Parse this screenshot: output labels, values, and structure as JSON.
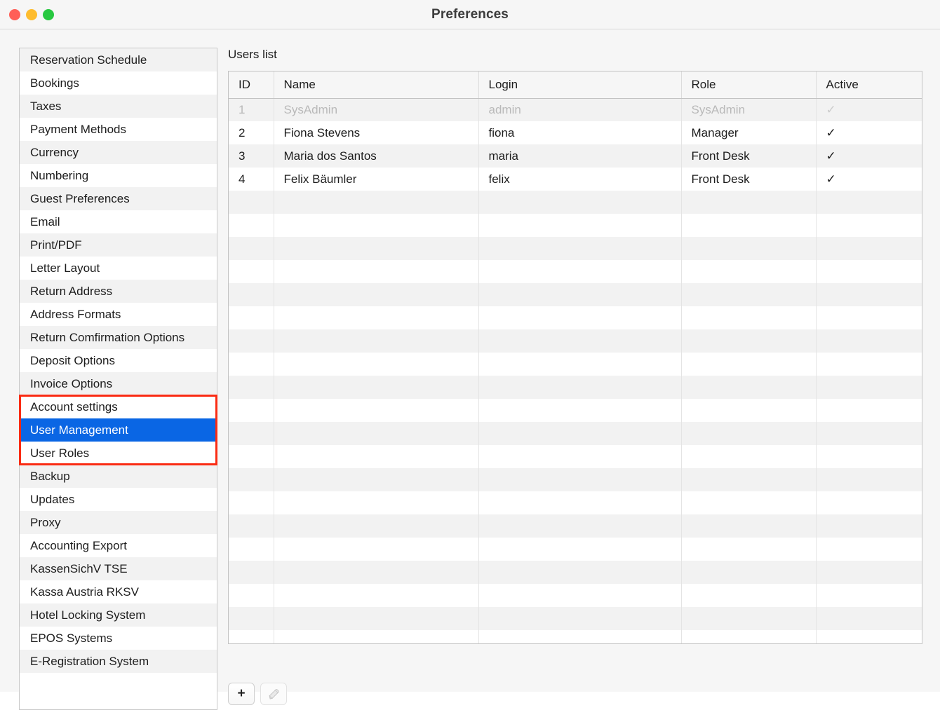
{
  "window": {
    "title": "Preferences",
    "traffic_lights": [
      {
        "name": "close-button",
        "color": "#ff5f57"
      },
      {
        "name": "minimize-button",
        "color": "#febc2e"
      },
      {
        "name": "zoom-button",
        "color": "#28c840"
      }
    ]
  },
  "sidebar": {
    "items": [
      {
        "label": "Reservation Schedule",
        "selected": false
      },
      {
        "label": "Bookings",
        "selected": false
      },
      {
        "label": "Taxes",
        "selected": false
      },
      {
        "label": "Payment Methods",
        "selected": false
      },
      {
        "label": "Currency",
        "selected": false
      },
      {
        "label": "Numbering",
        "selected": false
      },
      {
        "label": "Guest Preferences",
        "selected": false
      },
      {
        "label": "Email",
        "selected": false
      },
      {
        "label": "Print/PDF",
        "selected": false
      },
      {
        "label": "Letter Layout",
        "selected": false
      },
      {
        "label": "Return Address",
        "selected": false
      },
      {
        "label": "Address Formats",
        "selected": false
      },
      {
        "label": "Return Comfirmation Options",
        "selected": false
      },
      {
        "label": "Deposit Options",
        "selected": false
      },
      {
        "label": "Invoice Options",
        "selected": false
      },
      {
        "label": "Account settings",
        "selected": false
      },
      {
        "label": "User Management",
        "selected": true
      },
      {
        "label": "User Roles",
        "selected": false
      },
      {
        "label": "Backup",
        "selected": false
      },
      {
        "label": "Updates",
        "selected": false
      },
      {
        "label": "Proxy",
        "selected": false
      },
      {
        "label": "Accounting Export",
        "selected": false
      },
      {
        "label": "KassenSichV TSE",
        "selected": false
      },
      {
        "label": "Kassa Austria RKSV",
        "selected": false
      },
      {
        "label": "Hotel Locking System",
        "selected": false
      },
      {
        "label": "EPOS Systems",
        "selected": false
      },
      {
        "label": "E-Registration System",
        "selected": false
      }
    ],
    "selected_color": "#0a66e4"
  },
  "annotation": {
    "highlight_color": "#fa2b13",
    "highlighted_items": [
      "Account settings",
      "User Management",
      "User Roles"
    ]
  },
  "main": {
    "label": "Users list",
    "table": {
      "columns": [
        "ID",
        "Name",
        "Login",
        "Role",
        "Active"
      ],
      "rows": [
        {
          "id": "1",
          "name": "SysAdmin",
          "login": "admin",
          "role": "SysAdmin",
          "active": "✓",
          "disabled": true
        },
        {
          "id": "2",
          "name": "Fiona Stevens",
          "login": "fiona",
          "role": "Manager",
          "active": "✓",
          "disabled": false
        },
        {
          "id": "3",
          "name": "Maria dos Santos",
          "login": "maria",
          "role": "Front Desk",
          "active": "✓",
          "disabled": false
        },
        {
          "id": "4",
          "name": "Felix Bäumler",
          "login": "felix",
          "role": "Front Desk",
          "active": "✓",
          "disabled": false
        }
      ],
      "empty_row_count": 20
    }
  },
  "toolbar": {
    "add_label": "+",
    "add_name": "add-user-button",
    "edit_name": "edit-user-button",
    "edit_enabled": false
  }
}
